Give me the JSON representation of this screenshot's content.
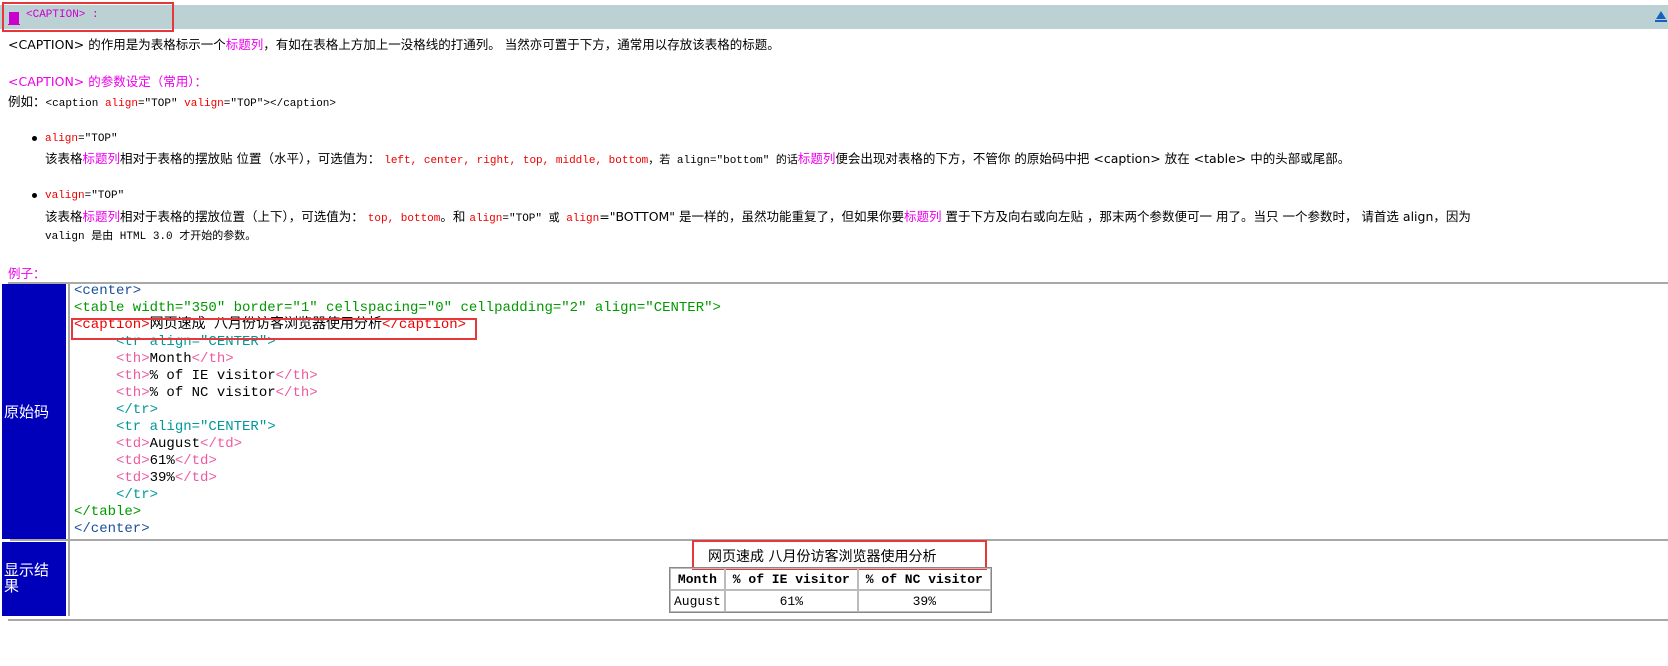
{
  "header": {
    "title": "<CAPTION> :",
    "up_icon": "triangle-up-icon"
  },
  "intro": {
    "p1_prefix": "<CAPTION> 的作用是为表格标示一个",
    "p1_highlight": "标题列",
    "p1_suffix": "，有如在表格上方加上一没格线的打通列。 当然亦可置于下方，通常用以存放该表格的标题。"
  },
  "params": {
    "heading": "<CAPTION> 的参数设定（常用）：",
    "example_prefix": "例如：",
    "example_tag_open": "<caption ",
    "example_attr1": "align",
    "example_val1": "=\"TOP\" ",
    "example_attr2": "valign",
    "example_val2": "=\"TOP\"></caption>"
  },
  "align_item": {
    "attr": "align",
    "value": "=\"TOP\"",
    "desc_a": "该表格",
    "desc_hl": "标题列",
    "desc_b": "相对于表格的摆放贴   位置（水平），可选值为： ",
    "options": "left, center, right, top, middle, bottom",
    "desc_c": "，若 align=\"bottom\" 的话",
    "desc_hl2": "标题列",
    "desc_d": "便会出现对表格的下方，不管你 的原始码中把 <caption> 放在 <table> 中的头部或尾部。"
  },
  "valign_item": {
    "attr": "valign",
    "value": "=\"TOP\"",
    "desc_a": "该表格",
    "desc_hl": "标题列",
    "desc_b": "相对于表格的摆放位置（上下），可选值为： ",
    "options": "top, bottom",
    "desc_c": "。和 ",
    "code1": "align",
    "code1v": "=\"TOP\" 或 ",
    "code2": "align",
    "code2v": "=\"BOTTOM\" 是一样的，虽然功能重复了，但如果你要",
    "desc_hl2": "标题列",
    "desc_d": " 置于下方及向右或向左贴   ，那末两个参数便可一  用了。当只  一个参数时，  请首选 align，因为",
    "line2": "valign 是由 HTML 3.0 才开始的参数。"
  },
  "example": {
    "heading": "例子：",
    "source_label": "原始码",
    "result_label": "显示结果",
    "code_lines": [
      [
        {
          "t": "<center>",
          "c": "blue"
        }
      ],
      [
        {
          "t": "<table width=\"350\" border=\"1\" cellspacing=\"0\" cellpadding=\"2\" align=\"CENTER\">",
          "c": "green"
        }
      ],
      [
        {
          "t": "<caption>",
          "c": "crimson"
        },
        {
          "t": "网页速成 八月份访客浏览器使用分析",
          "c": "blk"
        },
        {
          "t": "</caption>",
          "c": "crimson"
        }
      ],
      [
        {
          "t": "     <tr align=\"CENTER\">",
          "c": "tealg"
        }
      ],
      [
        {
          "t": "     <th>",
          "c": "pink"
        },
        {
          "t": "Month",
          "c": "blk"
        },
        {
          "t": "</th>",
          "c": "pink"
        }
      ],
      [
        {
          "t": "     <th>",
          "c": "pink"
        },
        {
          "t": "% of IE visitor",
          "c": "blk"
        },
        {
          "t": "</th>",
          "c": "pink"
        }
      ],
      [
        {
          "t": "     <th>",
          "c": "pink"
        },
        {
          "t": "% of NC visitor",
          "c": "blk"
        },
        {
          "t": "</th>",
          "c": "pink"
        }
      ],
      [
        {
          "t": "     </tr>",
          "c": "tealg"
        }
      ],
      [
        {
          "t": "     <tr align=\"CENTER\">",
          "c": "tealg"
        }
      ],
      [
        {
          "t": "     <td>",
          "c": "pink"
        },
        {
          "t": "August",
          "c": "blk"
        },
        {
          "t": "</td>",
          "c": "pink"
        }
      ],
      [
        {
          "t": "     <td>",
          "c": "pink"
        },
        {
          "t": "61%",
          "c": "blk"
        },
        {
          "t": "</td>",
          "c": "pink"
        }
      ],
      [
        {
          "t": "     <td>",
          "c": "pink"
        },
        {
          "t": "39%",
          "c": "blk"
        },
        {
          "t": "</td>",
          "c": "pink"
        }
      ],
      [
        {
          "t": "     </tr>",
          "c": "tealg"
        }
      ],
      [
        {
          "t": "</table>",
          "c": "green"
        }
      ],
      [
        {
          "t": "</center>",
          "c": "blue"
        }
      ]
    ],
    "result": {
      "caption": "网页速成 八月份访客浏览器使用分析",
      "headers": [
        "Month",
        "% of IE visitor",
        "% of NC visitor"
      ],
      "rows": [
        [
          "August",
          "61%",
          "39%"
        ]
      ]
    }
  },
  "colors": {
    "header_bg": "#bcd1d3",
    "accent_magenta": "#ee00ee",
    "label_bg": "#0000bb",
    "highlight_box": "#e8373b"
  }
}
